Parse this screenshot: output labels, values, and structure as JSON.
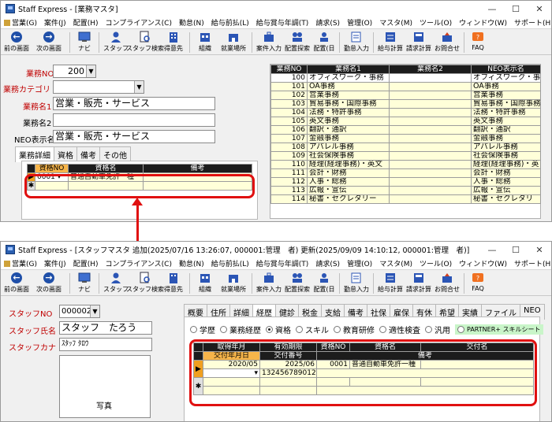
{
  "window1": {
    "title": "Staff Express - [業務マスタ]",
    "menu": [
      "営業(G)",
      "案件(J)",
      "配置(H)",
      "コンプライアンス(C)",
      "勤怠(N)",
      "給与前払(L)",
      "給与賞与年調(T)",
      "請求(S)",
      "管理(O)",
      "マスタ(M)",
      "ツール(O)",
      "ウィンドウ(W)",
      "サポート(H)"
    ],
    "toolbar": [
      "前の画面",
      "次の画面",
      "ナビ",
      "スタッフ",
      "スタッフ検索",
      "得意先",
      "組織",
      "就業場所",
      "案件入力",
      "配置探索",
      "配置(日",
      "勤怠入力",
      "給与計算",
      "請求計算",
      "お問合せ",
      "FAQ"
    ],
    "form": {
      "gyomu_no_label": "業務NO",
      "gyomu_no_value": "200",
      "category_label": "業務カテゴリ",
      "category_value": "",
      "name1_label": "業務名1",
      "name1_value": "営業・販売・サービス",
      "name2_label": "業務名2",
      "name2_value": "",
      "neo_label": "NEO表示名",
      "neo_value": "営業・販売・サービス"
    },
    "tabs": [
      "業務詳細",
      "資格",
      "備考",
      "その他"
    ],
    "sub_grid": {
      "headers": [
        "資格NO",
        "資格名",
        "備考"
      ],
      "row": {
        "no": "0001",
        "name": "普通自動車免許一種",
        "note": ""
      }
    },
    "list": {
      "headers": [
        "業務NO",
        "業務名1",
        "業務名2",
        "NEO表示名"
      ],
      "rows": [
        {
          "no": "100",
          "name1": "オフィスワーク・事務",
          "name2": "",
          "neo": "オフィスワーク・事"
        },
        {
          "no": "101",
          "name1": "OA事務",
          "name2": "",
          "neo": "OA事務"
        },
        {
          "no": "102",
          "name1": "営業事務",
          "name2": "",
          "neo": "営業事務"
        },
        {
          "no": "103",
          "name1": "貿易事務・国際事務",
          "name2": "",
          "neo": "貿易事務・国際事務"
        },
        {
          "no": "104",
          "name1": "法務・特許事務",
          "name2": "",
          "neo": "法務・特許事務"
        },
        {
          "no": "105",
          "name1": "英文事務",
          "name2": "",
          "neo": "英文事務"
        },
        {
          "no": "106",
          "name1": "翻訳・通訳",
          "name2": "",
          "neo": "翻訳・通訳"
        },
        {
          "no": "107",
          "name1": "金融事務",
          "name2": "",
          "neo": "金融事務"
        },
        {
          "no": "108",
          "name1": "アパレル事務",
          "name2": "",
          "neo": "アパレル事務"
        },
        {
          "no": "109",
          "name1": "社会保険事務",
          "name2": "",
          "neo": "社会保険事務"
        },
        {
          "no": "110",
          "name1": "経理(経理事務)・英文",
          "name2": "",
          "neo": "経理(経理事務)・英"
        },
        {
          "no": "111",
          "name1": "会計・財務",
          "name2": "",
          "neo": "会計・財務"
        },
        {
          "no": "112",
          "name1": "人事・総務",
          "name2": "",
          "neo": "人事・総務"
        },
        {
          "no": "113",
          "name1": "広報・宣伝",
          "name2": "",
          "neo": "広報・宣伝"
        },
        {
          "no": "114",
          "name1": "秘書・セクレタリー",
          "name2": "",
          "neo": "秘書・セクレタリ"
        }
      ]
    }
  },
  "window2": {
    "title": "Staff Express - [スタッフマスタ 追加(2025/07/16 13:26:07, 000001:管理　者) 更新(2025/09/09 14:10:12, 000001:管理　者)]",
    "form": {
      "staff_no_label": "スタッフNO",
      "staff_no_value": "000002",
      "staff_name_label": "スタッフ氏名",
      "staff_name_value": "スタッフ　たろう",
      "staff_kana_label": "スタッフカナ",
      "staff_kana_value": "ｽﾀｯﾌ ﾀﾛｳ",
      "photo_label": "写真"
    },
    "tabs": [
      "概要",
      "住所",
      "詳細",
      "経歴",
      "健診",
      "税金",
      "支給",
      "備考",
      "社保",
      "雇保",
      "有休",
      "希望",
      "実績",
      "ファイル",
      "NEO"
    ],
    "radios": [
      "学歴",
      "業務経歴",
      "資格",
      "スキル",
      "教育研修",
      "適性検査",
      "汎用"
    ],
    "radio_selected": "資格",
    "partner_label": "PARTNER+ スキルシート",
    "grid": {
      "headers_top": [
        "取得年月",
        "有効期限",
        "資格NO",
        "資格名",
        "交付名"
      ],
      "headers_sub": [
        "交付年月日",
        "交付番号",
        "備考"
      ],
      "row": {
        "acquired": "2020/05",
        "expiry": "2025/06",
        "no": "0001",
        "name": "普通自動車免許一種",
        "issuer": "",
        "issued_date": "",
        "issue_no": "132456789012",
        "note": ""
      }
    }
  }
}
